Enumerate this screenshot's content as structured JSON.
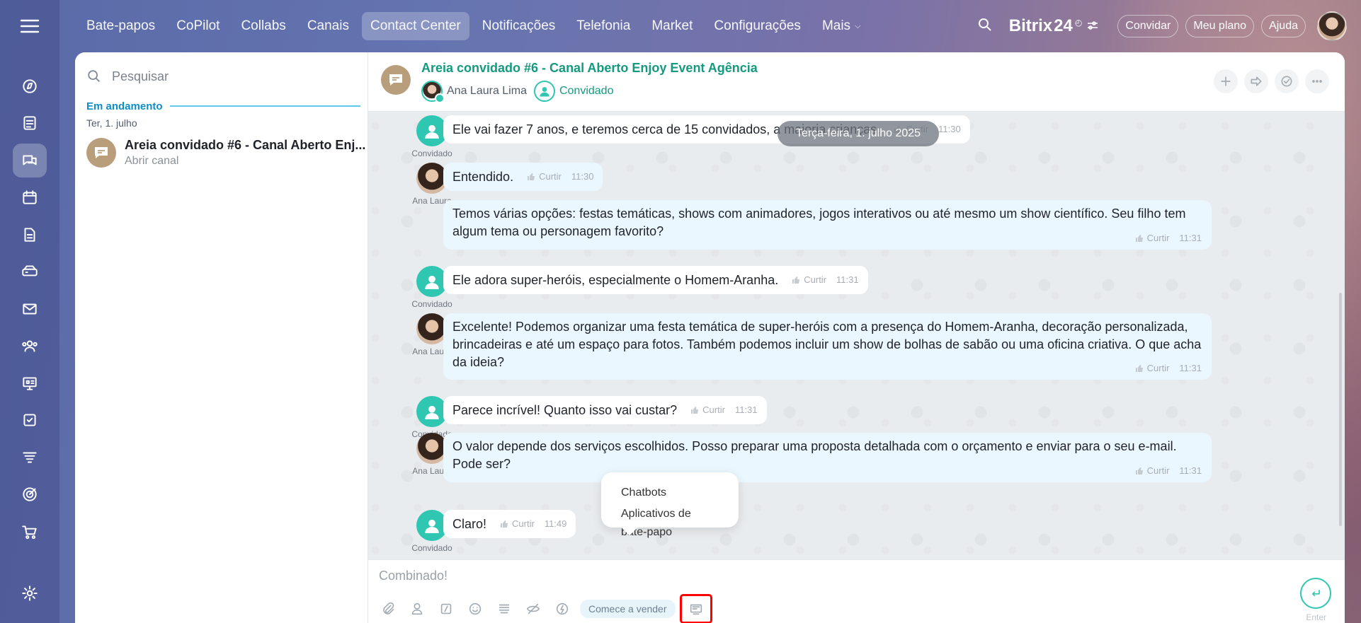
{
  "topnav": {
    "items": [
      {
        "label": "Bate-papos",
        "active": false
      },
      {
        "label": "CoPilot",
        "active": false
      },
      {
        "label": "Collabs",
        "active": false
      },
      {
        "label": "Canais",
        "active": false
      },
      {
        "label": "Contact Center",
        "active": true
      },
      {
        "label": "Notificações",
        "active": false
      },
      {
        "label": "Telefonia",
        "active": false
      },
      {
        "label": "Market",
        "active": false
      },
      {
        "label": "Configurações",
        "active": false
      },
      {
        "label": "Mais",
        "active": false
      }
    ],
    "logo_text": "Bitrix",
    "logo_num": "24",
    "invite_label": "Convidar",
    "plan_label": "Meu plano",
    "help_label": "Ajuda"
  },
  "sidebar": {
    "icons": [
      "compass-icon",
      "feed-icon",
      "chat-icon",
      "calendar-icon",
      "document-icon",
      "drive-icon",
      "mail-icon",
      "users-icon",
      "crm-icon",
      "tasks-icon",
      "filter-icon",
      "target-icon",
      "cart-icon",
      "settings-icon"
    ],
    "active_index": 2
  },
  "left": {
    "search_placeholder": "Pesquisar",
    "group_title": "Em andamento",
    "date_label": "Ter, 1. julho",
    "chat_title": "Areia convidado #6 - Canal Aberto Enj...",
    "chat_sub": "Abrir canal"
  },
  "chat": {
    "title": "Areia convidado #6 - Canal Aberto Enjoy Event Agência",
    "member1": "Ana Laura Lima",
    "member2": "Convidado",
    "date_chip": "Terça-feira, 1. julho 2025",
    "like_label": "Curtir",
    "guest_name": "Convidado",
    "ana_name": "Ana Laura",
    "messages": [
      {
        "author": "guest",
        "text": "Ele vai fazer 7 anos, e teremos cerca de 15 convidados, a maioria crianças.",
        "time": "11:30"
      },
      {
        "author": "ana",
        "text": "Entendido.",
        "time": "11:30"
      },
      {
        "author": "ana",
        "text": "Temos várias opções: festas temáticas, shows com animadores, jogos interativos ou até mesmo um show científico. Seu filho tem algum tema ou personagem favorito?",
        "time": "11:31"
      },
      {
        "author": "guest",
        "text": "Ele adora super-heróis, especialmente o Homem-Aranha.",
        "time": "11:31"
      },
      {
        "author": "ana",
        "text": "Excelente! Podemos organizar uma festa temática de super-heróis com a presença do Homem-Aranha, decoração personalizada, brincadeiras e até um espaço para fotos. Também podemos incluir um show de bolhas de sabão ou uma oficina criativa. O que acha da ideia?",
        "time": "11:31"
      },
      {
        "author": "guest",
        "text": "Parece incrível! Quanto isso vai custar?",
        "time": "11:31"
      },
      {
        "author": "ana",
        "text": "O valor depende dos serviços escolhidos. Posso preparar uma proposta detalhada com o orçamento e enviar para o seu e-mail. Pode ser?",
        "time": "11:31"
      },
      {
        "author": "guest",
        "text": "Claro!",
        "time": "11:49"
      }
    ]
  },
  "popup": {
    "options": [
      "Chatbots",
      "Aplicativos de bate-papo"
    ]
  },
  "composer": {
    "text": "Combinado!",
    "sell_label": "Comece a vender",
    "enter_label": "Enter"
  },
  "colors": {
    "accent": "#2fc6b2",
    "title_green": "#159a7f",
    "highlight": "#ff0000"
  }
}
